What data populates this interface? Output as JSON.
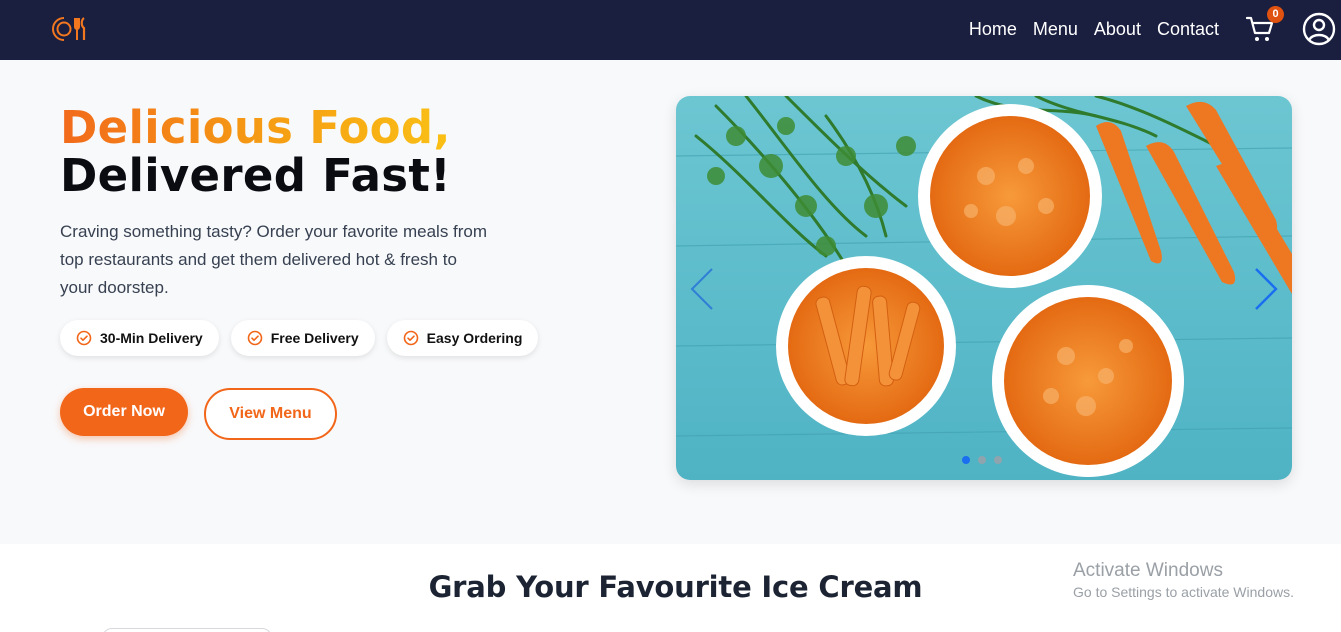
{
  "brand": {
    "logo_icon": "plate-fork-knife-icon",
    "accent": "#f2661a"
  },
  "nav": {
    "links": [
      "Home",
      "Menu",
      "About",
      "Contact"
    ],
    "cart_count": "0",
    "cart_icon": "cart-icon",
    "user_icon": "user-icon",
    "background": "#1a1e3f"
  },
  "hero": {
    "title_line1": "Delicious Food,",
    "title_line2": "Delivered Fast!",
    "description": "Craving something tasty? Order your favorite meals from top restaurants and get them delivered hot & fresh to your doorstep.",
    "badges": [
      "30-Min Delivery",
      "Free Delivery",
      "Easy Ordering"
    ],
    "primary_button": "Order Now",
    "secondary_button": "View Menu"
  },
  "carousel": {
    "image": "bowls of carrot snacks and fresh carrots on blue wood",
    "slide_count": 3,
    "active_slide": 1
  },
  "section": {
    "title": "Grab Your Favourite Ice Cream"
  },
  "watermark": {
    "line1": "Activate Windows",
    "line2": "Go to Settings to activate Windows."
  }
}
